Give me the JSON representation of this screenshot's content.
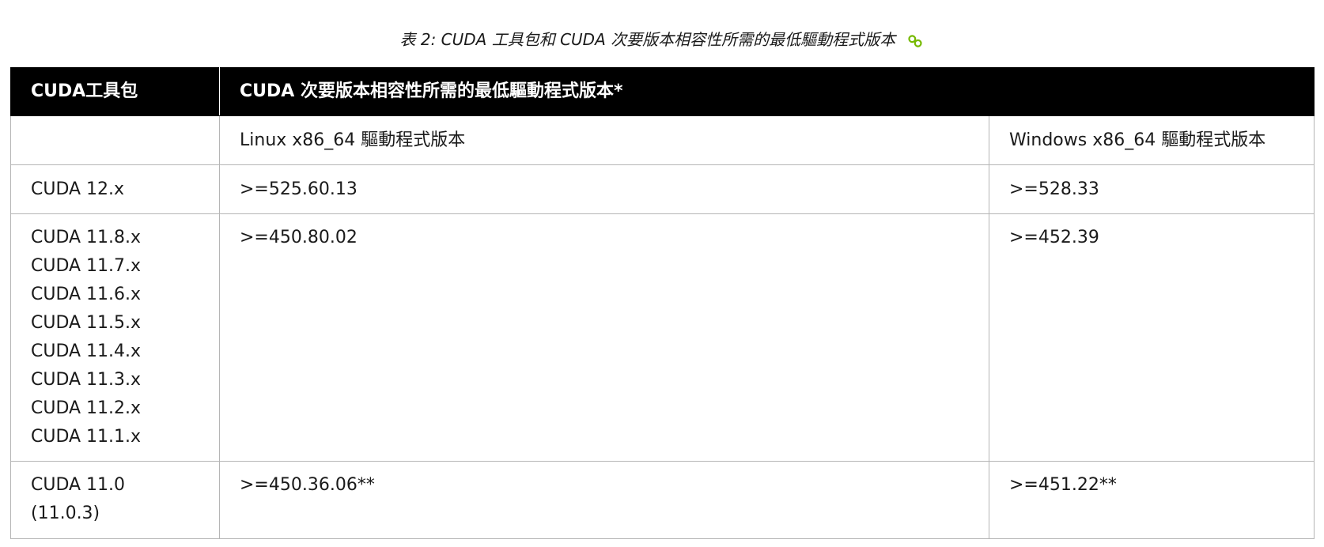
{
  "caption": {
    "text": "表 2: CUDA 工具包和 CUDA 次要版本相容性所需的最低驅動程式版本",
    "icon": "link-icon",
    "icon_color": "#76b900"
  },
  "table": {
    "header": {
      "col1": "CUDA工具包",
      "col2": "CUDA 次要版本相容性所需的最低驅動程式版本*"
    },
    "subheader": {
      "col1": "",
      "col2": "Linux x86_64 驅動程式版本",
      "col3": "Windows x86_64 驅動程式版本"
    },
    "rows": [
      {
        "toolkits": [
          "CUDA 12.x"
        ],
        "linux": ">=525.60.13",
        "windows": ">=528.33"
      },
      {
        "toolkits": [
          "CUDA 11.8.x",
          "CUDA 11.7.x",
          "CUDA 11.6.x",
          "CUDA 11.5.x",
          "CUDA 11.4.x",
          "CUDA 11.3.x",
          "CUDA 11.2.x",
          "CUDA 11.1.x"
        ],
        "linux": ">=450.80.02",
        "windows": ">=452.39"
      },
      {
        "toolkits": [
          "CUDA 11.0",
          "(11.0.3)"
        ],
        "linux": ">=450.36.06**",
        "windows": ">=451.22**"
      }
    ]
  },
  "colors": {
    "header_bg": "#000000",
    "header_text": "#ffffff",
    "border": "#b5b5b5"
  }
}
